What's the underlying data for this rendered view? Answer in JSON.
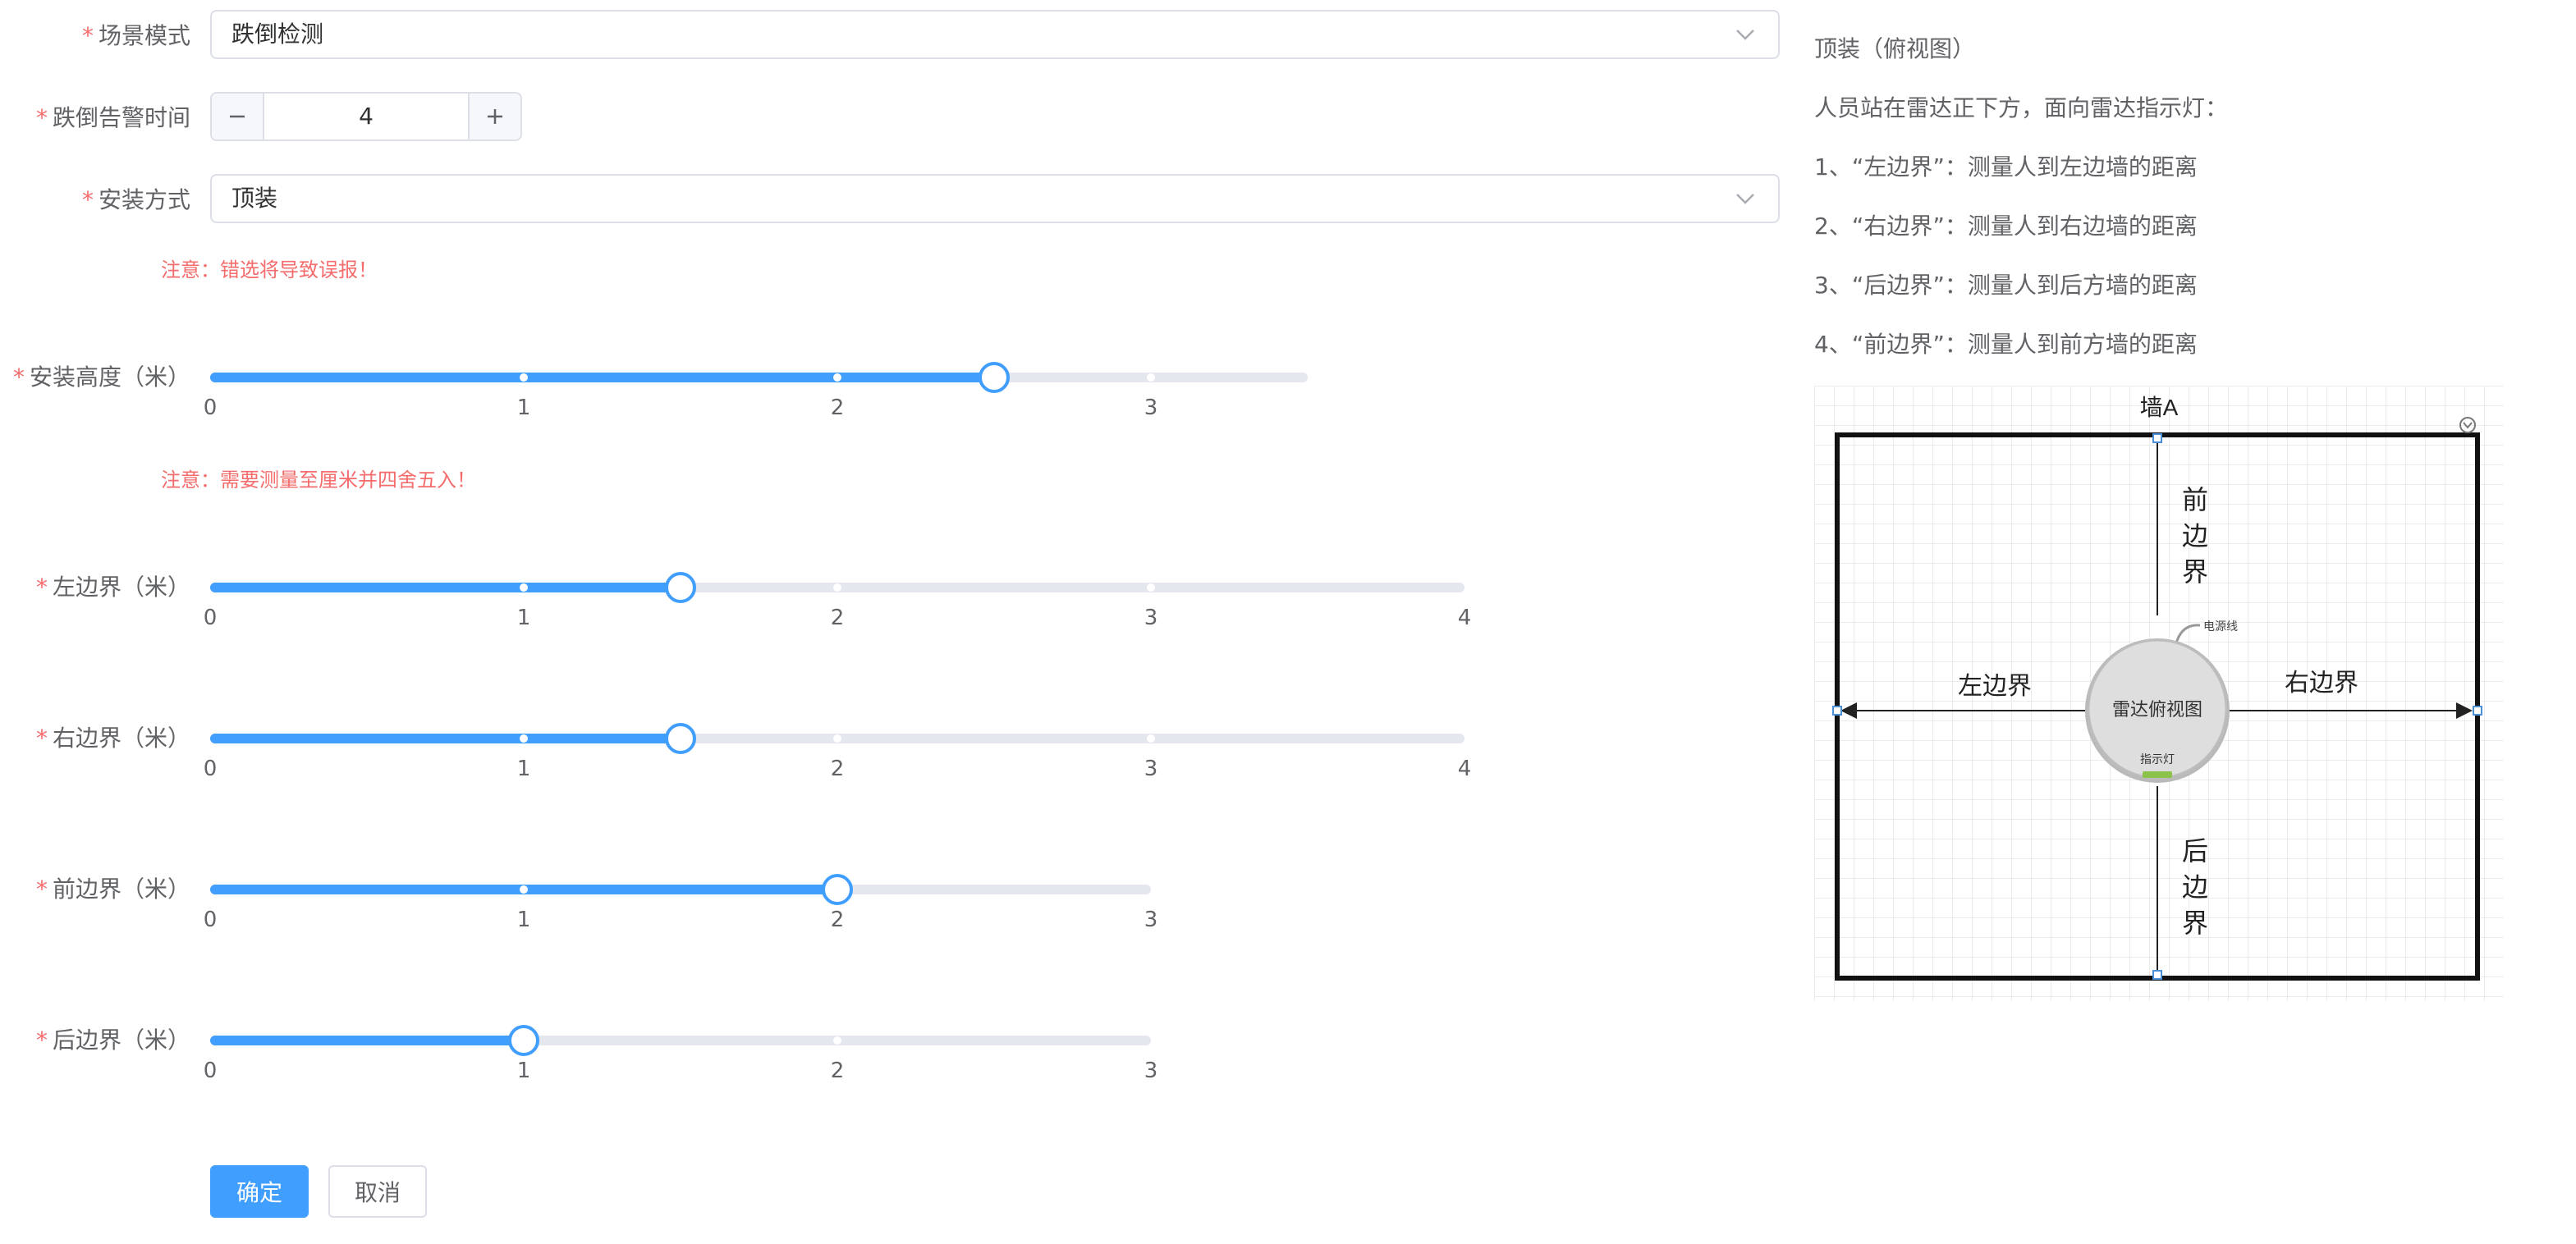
{
  "form": {
    "scene_mode": {
      "label": "场景模式",
      "value": "跌倒检测"
    },
    "fall_alarm_time": {
      "label": "跌倒告警时间",
      "value": "4",
      "minus": "−",
      "plus": "+"
    },
    "install_mode": {
      "label": "安装方式",
      "value": "顶装",
      "note": "注意：错选将导致误报！"
    },
    "install_height": {
      "label": "安装高度（米）",
      "value": 2.5,
      "max": 3.5,
      "marks": [
        "0",
        "1",
        "2",
        "3"
      ],
      "note": "注意：需要测量至厘米并四舍五入！"
    },
    "left_boundary": {
      "label": "左边界（米）",
      "value": 1.5,
      "max": 4,
      "marks": [
        "0",
        "1",
        "2",
        "3",
        "4"
      ]
    },
    "right_boundary": {
      "label": "右边界（米）",
      "value": 1.5,
      "max": 4,
      "marks": [
        "0",
        "1",
        "2",
        "3",
        "4"
      ]
    },
    "front_boundary": {
      "label": "前边界（米）",
      "value": 2,
      "max": 3,
      "marks": [
        "0",
        "1",
        "2",
        "3"
      ]
    },
    "back_boundary": {
      "label": "后边界（米）",
      "value": 1,
      "max": 3,
      "marks": [
        "0",
        "1",
        "2",
        "3"
      ]
    },
    "required_mark": "*",
    "confirm_label": "确定",
    "cancel_label": "取消"
  },
  "help": {
    "title": "顶装（俯视图）",
    "intro": "人员站在雷达正下方，面向雷达指示灯：",
    "items": [
      "1、“左边界”：测量人到左边墙的距离",
      "2、“右边界”：测量人到右边墙的距离",
      "3、“后边界”：测量人到后方墙的距离",
      "4、“前边界”：测量人到前方墙的距离"
    ]
  },
  "diagram": {
    "wall": "墙A",
    "front": [
      "前",
      "边",
      "界"
    ],
    "back": [
      "后",
      "边",
      "界"
    ],
    "left": "左边界",
    "right": "右边界",
    "radar": "雷达俯视图",
    "cable": "电源线",
    "indicator": "指示灯"
  },
  "colors": {
    "primary": "#409eff",
    "danger": "#f56c6c",
    "indicator": "#8bc34a"
  }
}
